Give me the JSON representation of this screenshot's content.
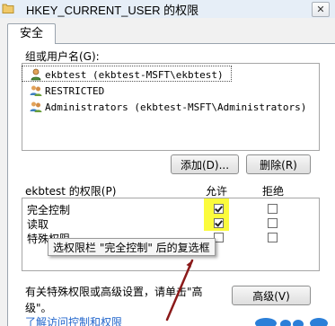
{
  "window": {
    "title": "HKEY_CURRENT_USER 的权限",
    "close_glyph": "✕"
  },
  "tabs": [
    {
      "label": "安全"
    }
  ],
  "groups": {
    "label": "组或用户名(G):",
    "items": [
      {
        "name": "ekbtest (ekbtest-MSFT\\ekbtest)",
        "icon": "user-icon"
      },
      {
        "name": "RESTRICTED",
        "icon": "group-icon"
      },
      {
        "name": "Administrators (ekbtest-MSFT\\Administrators)",
        "icon": "group-icon"
      }
    ],
    "add_label": "添加(D)...",
    "remove_label": "删除(R)"
  },
  "permissions": {
    "label": "ekbtest 的权限(P)",
    "allow_header": "允许",
    "deny_header": "拒绝",
    "rows": [
      {
        "name": "完全控制",
        "allow": true,
        "deny": false
      },
      {
        "name": "读取",
        "allow": true,
        "deny": false
      },
      {
        "name": "特殊权限",
        "allow": false,
        "deny": false
      }
    ]
  },
  "tooltip": "选权限栏 \"完全控制\" 后的复选框",
  "footer": {
    "line1": "有关特殊权限或高级设置，请单击\"高",
    "line2": "级\"。",
    "advanced_label": "高级(V)",
    "link": "了解访问控制和权限"
  },
  "colors": {
    "highlight": "#fbfb3c",
    "arrow": "#8b1a1a",
    "link": "#2266cc"
  }
}
